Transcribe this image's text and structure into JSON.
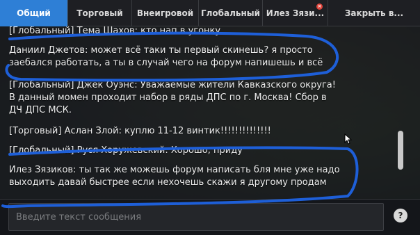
{
  "tabs": [
    {
      "label": "Общий",
      "active": true
    },
    {
      "label": "Торговый",
      "active": false
    },
    {
      "label": "Внеигровой",
      "active": false
    },
    {
      "label": "Глобальный",
      "active": false
    },
    {
      "label": "Илез Зязи...",
      "active": false,
      "close": "×"
    },
    {
      "label": "Закрыть в...",
      "active": false
    }
  ],
  "messages": [
    {
      "text": "[Глобальный] Тема Шахов: кто нап в угонку"
    },
    {
      "text": "Даниил Джетов: может всё таки ты первый скинешь? я просто\nзаебался работать, а ты в случай чего на форум напишешь и всё"
    },
    {
      "text": "[Глобальный] Джек Оуэнс: Уважаемые жители Кавказского округа!\nВ данный момен проходит набор в ряды ДПС по г. Москва! Сбор в\nДЧ ДПС МСК."
    },
    {
      "text": "[Торговый] Аслан Злой: куплю 11-12 винтик!!!!!!!!!!!!!!"
    },
    {
      "text": "[Глобальный] Руся Хоружевский: Хорошо, приду"
    },
    {
      "text": "Илез Зязиков: ты так же можешь форум написать бля мне уже надо\nвыходить давай быстрее если нехочешь скажи я другому продам"
    }
  ],
  "input": {
    "placeholder": "Введите текст сообщения"
  },
  "help_button": "?",
  "colors": {
    "accent": "#2e7fd6",
    "annotation": "#1e5fd8",
    "close_badge": "#e0453c"
  }
}
